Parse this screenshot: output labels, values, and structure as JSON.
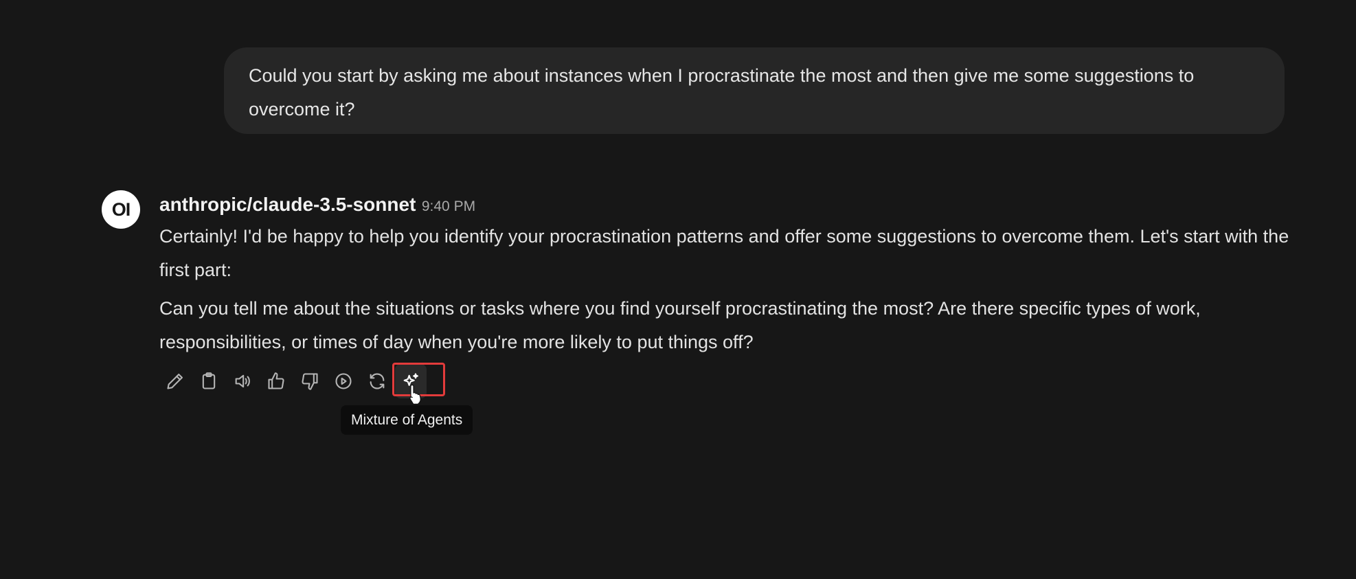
{
  "user_message": {
    "text": "Could you start by asking me about instances when I procrastinate the most and then give me some suggestions to overcome it?"
  },
  "assistant_message": {
    "avatar_text": "OI",
    "model_name": "anthropic/claude-3.5-sonnet",
    "timestamp": "9:40 PM",
    "paragraphs": [
      "Certainly! I'd be happy to help you identify your procrastination patterns and offer some suggestions to overcome them. Let's start with the first part:",
      "Can you tell me about the situations or tasks where you find yourself procrastinating the most? Are there specific types of work, responsibilities, or times of day when you're more likely to put things off?"
    ]
  },
  "actions": [
    {
      "name": "edit",
      "icon": "pencil-icon"
    },
    {
      "name": "copy",
      "icon": "clipboard-icon"
    },
    {
      "name": "read-aloud",
      "icon": "speaker-icon"
    },
    {
      "name": "good-response",
      "icon": "thumbs-up-icon"
    },
    {
      "name": "bad-response",
      "icon": "thumbs-down-icon"
    },
    {
      "name": "continue-response",
      "icon": "play-circle-icon"
    },
    {
      "name": "regenerate",
      "icon": "refresh-icon"
    },
    {
      "name": "mixture-of-agents",
      "icon": "sparkles-icon",
      "active": true
    }
  ],
  "tooltip": {
    "text": "Mixture of Agents"
  },
  "colors": {
    "background": "#171717",
    "user_bubble": "#262626",
    "highlight": "#e33b3b",
    "tooltip_bg": "#0c0c0c"
  }
}
